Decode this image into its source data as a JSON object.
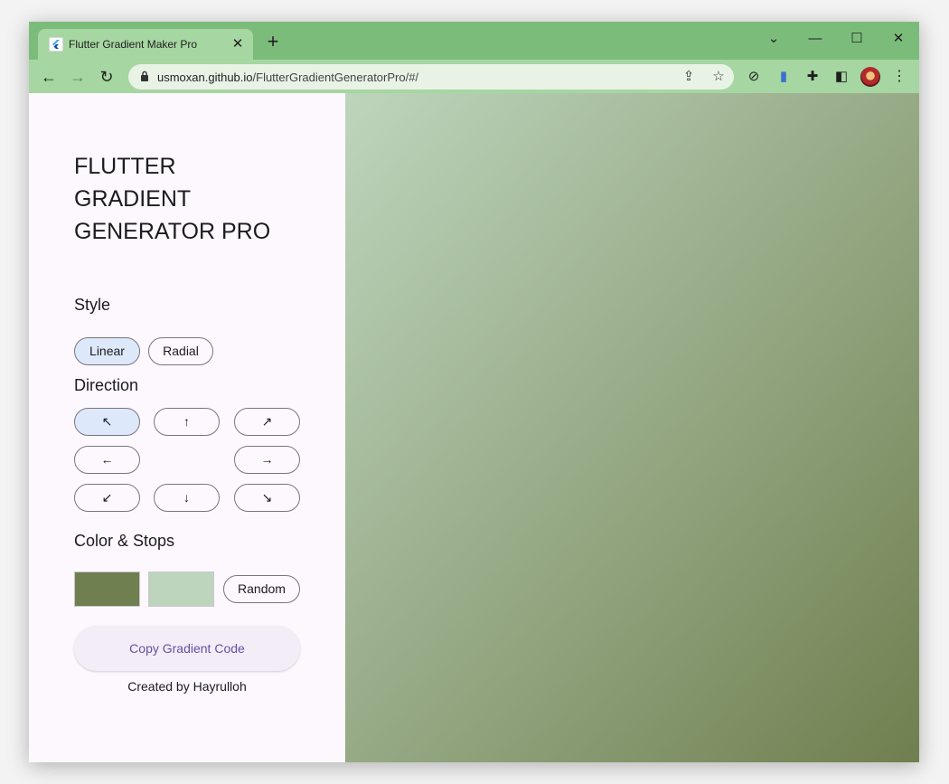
{
  "browser": {
    "tab_title": "Flutter Gradient Maker Pro",
    "tab_close": "✕",
    "new_tab": "+",
    "url_host": "usmoxan.github.io",
    "url_path": "/FlutterGradientGeneratorPro/#/",
    "controls": {
      "dropdown": "⌄",
      "minimize": "—",
      "maximize": "☐",
      "close": "✕"
    },
    "nav": {
      "back": "←",
      "forward": "→",
      "reload": "↻"
    },
    "accent_color": "#7cbc7b"
  },
  "app": {
    "title_lines": [
      "FLUTTER",
      "GRADIENT",
      "GENERATOR PRO"
    ],
    "style_heading": "Style",
    "style_options": [
      "Linear",
      "Radial"
    ],
    "style_selected": "Linear",
    "direction_heading": "Direction",
    "directions": {
      "top_left": "↖",
      "top": "↑",
      "top_right": "↗",
      "left": "←",
      "right": "→",
      "bottom_left": "↙",
      "bottom": "↓",
      "bottom_right": "↘"
    },
    "direction_selected": "top_left",
    "color_heading": "Color & Stops",
    "colors": [
      "#6f7f4f",
      "#bed5bd"
    ],
    "random_label": "Random",
    "copy_label": "Copy Gradient Code",
    "credit": "Created by Hayrulloh"
  }
}
